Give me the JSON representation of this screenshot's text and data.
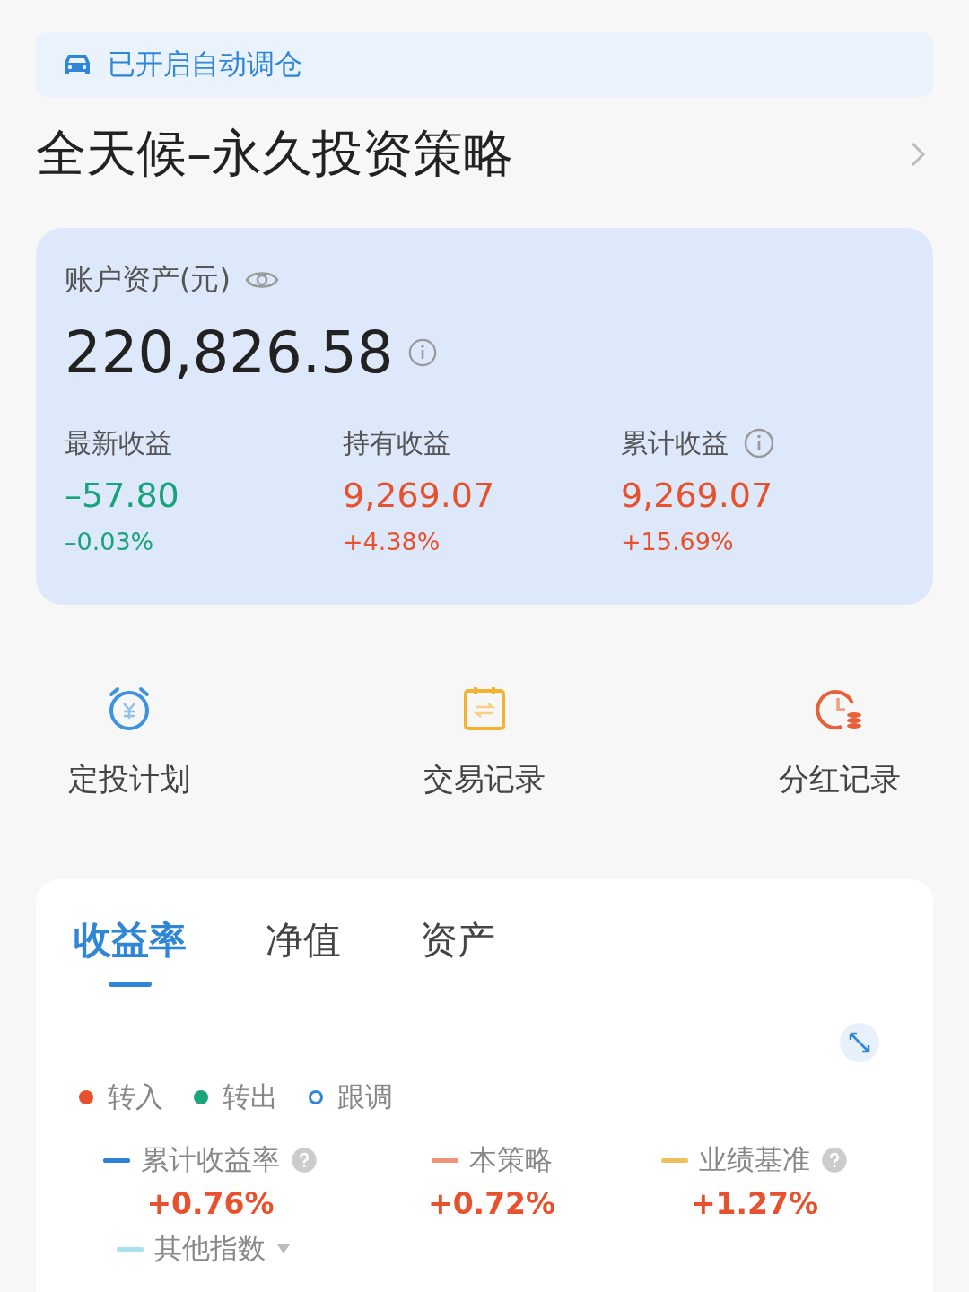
{
  "banner": {
    "text": "已开启自动调仓"
  },
  "title": "全天候–永久投资策略",
  "account": {
    "label": "账户资产(元)",
    "total": "220,826.58",
    "metrics": [
      {
        "label": "最新收益",
        "value": "–57.80",
        "percent": "–0.03%",
        "color": "#1aa37a",
        "info": false
      },
      {
        "label": "持有收益",
        "value": "9,269.07",
        "percent": "+4.38%",
        "color": "#e8512d",
        "info": false
      },
      {
        "label": "累计收益",
        "value": "9,269.07",
        "percent": "+15.69%",
        "color": "#e8512d",
        "info": true
      }
    ]
  },
  "actions": [
    {
      "label": "定投计划",
      "kind": "plan"
    },
    {
      "label": "交易记录",
      "kind": "trade"
    },
    {
      "label": "分红记录",
      "kind": "dividend"
    }
  ],
  "tabs": [
    {
      "label": "收益率",
      "selected": true
    },
    {
      "label": "净值",
      "selected": false
    },
    {
      "label": "资产",
      "selected": false
    }
  ],
  "markers": [
    {
      "label": "转入",
      "color": "#e8512d",
      "kind": "dot"
    },
    {
      "label": "转出",
      "color": "#18a57a",
      "kind": "dot"
    },
    {
      "label": "跟调",
      "color": "#2f86d6",
      "kind": "ring"
    }
  ],
  "series": [
    {
      "label": "累计收益率",
      "color": "#2f7fd6",
      "value": "+0.76%",
      "help": true
    },
    {
      "label": "本策略",
      "color": "#f0917a",
      "value": "+0.72%",
      "help": false
    },
    {
      "label": "业绩基准",
      "color": "#f0c060",
      "value": "+1.27%",
      "help": true
    }
  ],
  "other_index": {
    "label": "其他指数",
    "color": "#a8e0ee"
  }
}
